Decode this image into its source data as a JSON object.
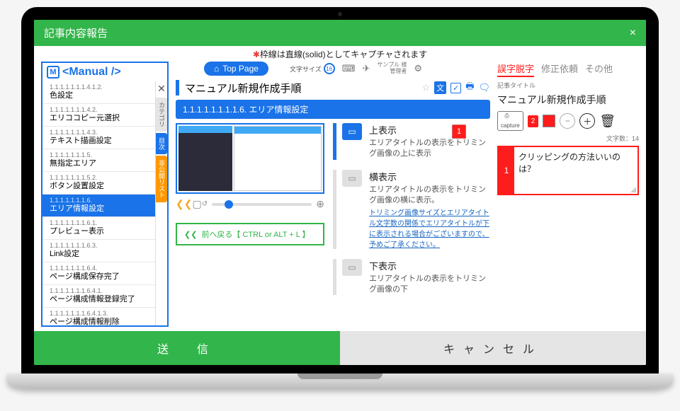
{
  "modal_title": "記事内容報告",
  "notice": {
    "prefix": "✱",
    "text": "枠線は直線(solid)としてキャプチャされます"
  },
  "sidebar": {
    "brand": "<Manual />",
    "items": [
      {
        "num": "1.1.1.1.1.1.1.4.1.2.",
        "label": "色設定"
      },
      {
        "num": "1.1.1.1.1.1.1.4.2.",
        "label": "エリココピー元選択"
      },
      {
        "num": "1.1.1.1.1.1.1.4.3.",
        "label": "テキスト描画設定"
      },
      {
        "num": "1.1.1.1.1.1.1.5.",
        "label": "無指定エリア"
      },
      {
        "num": "1.1.1.1.1.1.1.5.2.",
        "label": "ボタン設置設定"
      },
      {
        "num": "1.1.1.1.1.1.1.6.",
        "label": "エリア情報設定"
      },
      {
        "num": "1.1.1.1.1.1.1.6.1.",
        "label": "プレビュー表示"
      },
      {
        "num": "1.1.1.1.1.1.1.6.3.",
        "label": "Link設定"
      },
      {
        "num": "1.1.1.1.1.1.1.6.4.",
        "label": "ページ構成保存完了"
      },
      {
        "num": "1.1.1.1.1.1.1.6.4.1.",
        "label": "ページ構成情報登録完了"
      },
      {
        "num": "1.1.1.1.1.1.1.6.4.1.3.",
        "label": "ページ構成情報削除"
      }
    ],
    "active_index": 5,
    "side_tabs": [
      "カテゴリ",
      "目次",
      "非公開リスト"
    ]
  },
  "center": {
    "top_page": "Top Page",
    "font_size_label": "文字サイズ",
    "font_size_value": "16",
    "sample_user": "サンプル 様\n管理者",
    "page_title": "マニュアル新規作成手順",
    "breadcrumb": "1.1.1.1.1.1.1.1.6. エリア情報設定",
    "back_button": "前へ戻る【 CTRL or ALT + L 】",
    "options": [
      {
        "title": "上表示",
        "desc": "エリアタイトルの表示をトリミング画像の上に表示",
        "selected": true,
        "marker": "1"
      },
      {
        "title": "横表示",
        "desc": "エリアタイトルの表示をトリミング画像の横に表示。",
        "link": "トリミング画像サイズとエリアタイトル文字数の関係でエリアタイトルが下に表示される場合がございますので、予めご了承ください。",
        "selected": false
      },
      {
        "title": "下表示",
        "desc": "エリアタイトルの表示をトリミング画像の下",
        "selected": false
      }
    ]
  },
  "right": {
    "tabs": [
      "誤字脱字",
      "修正依頼",
      "その他"
    ],
    "active_tab": 0,
    "article_title_label": "記事タイトル",
    "article_title": "マニュアル新規作成手順",
    "capture_label": "capture",
    "badge_num": "2",
    "char_count_label": "文字数：",
    "char_count": "14",
    "comment_num": "1",
    "comment_text": "クリッピングの方法いいのは？"
  },
  "footer": {
    "submit": "送　信",
    "cancel": "キャンセル"
  }
}
